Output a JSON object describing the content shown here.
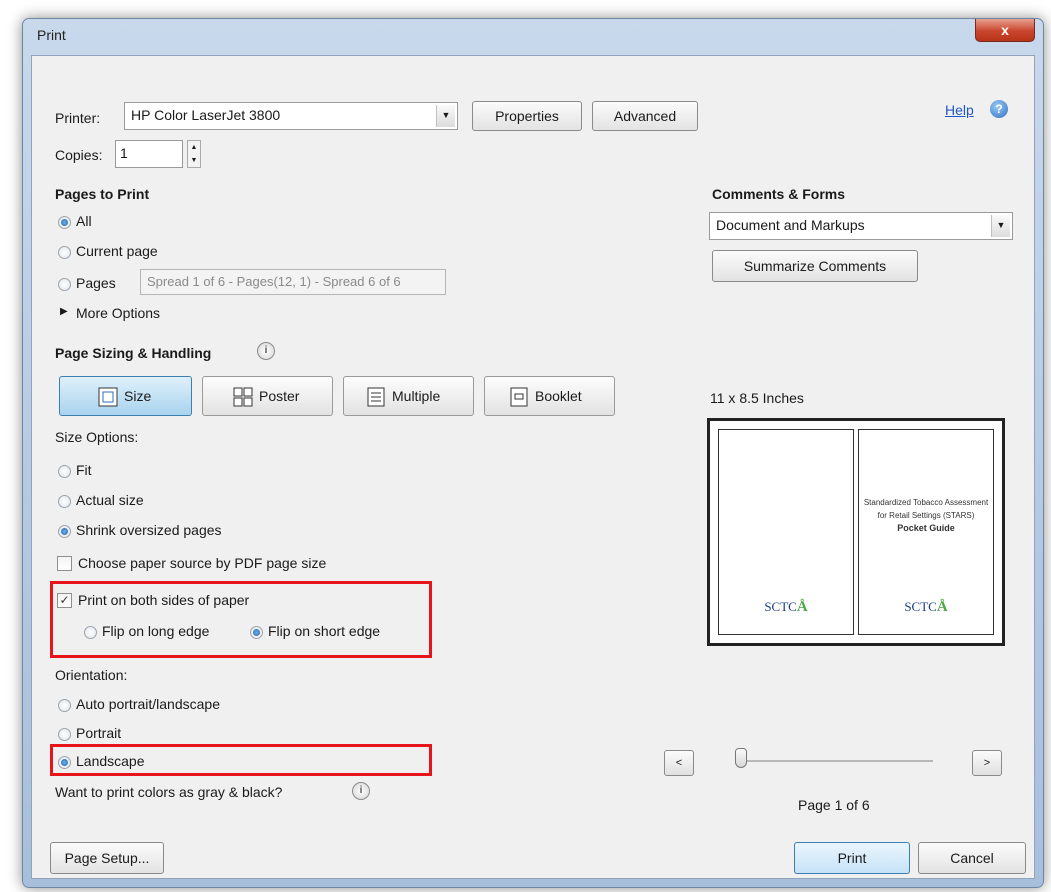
{
  "window": {
    "title": "Print",
    "close_glyph": "x"
  },
  "printer": {
    "label": "Printer:",
    "value": "HP Color LaserJet 3800",
    "properties_label": "Properties",
    "advanced_label": "Advanced",
    "help_label": "Help",
    "help_icon": "help-icon"
  },
  "copies": {
    "label": "Copies:",
    "value": "1"
  },
  "pages_to_print": {
    "heading": "Pages to Print",
    "all_label": "All",
    "current_label": "Current page",
    "pages_label": "Pages",
    "pages_value": "Spread 1 of 6 - Pages(12, 1) - Spread 6 of 6",
    "more_options_label": "More Options",
    "selected": "All"
  },
  "sizing": {
    "heading": "Page Sizing & Handling",
    "tabs": [
      {
        "label": "Size",
        "icon": "size-icon"
      },
      {
        "label": "Poster",
        "icon": "poster-icon"
      },
      {
        "label": "Multiple",
        "icon": "multiple-icon"
      },
      {
        "label": "Booklet",
        "icon": "booklet-icon"
      }
    ],
    "active_tab": "Size",
    "size_options_label": "Size Options:",
    "fit_label": "Fit",
    "actual_label": "Actual size",
    "shrink_label": "Shrink oversized pages",
    "selected_size_option": "Shrink oversized pages",
    "choose_source_label": "Choose paper source by PDF page size",
    "choose_source_checked": false,
    "duplex_label": "Print on both sides of paper",
    "duplex_checked": true,
    "flip_long_label": "Flip on long edge",
    "flip_short_label": "Flip on short edge",
    "flip_selected": "Flip on short edge"
  },
  "orientation": {
    "label": "Orientation:",
    "auto_label": "Auto portrait/landscape",
    "portrait_label": "Portrait",
    "landscape_label": "Landscape",
    "selected": "Landscape"
  },
  "gray_label": "Want to print colors as gray & black?",
  "comments_forms": {
    "heading": "Comments & Forms",
    "value": "Document and Markups",
    "summarize_label": "Summarize Comments"
  },
  "preview": {
    "size_label": "11 x 8.5 Inches",
    "right_page_text": "Standardized Tobacco Assessment for Retail Settings (STARS) Pocket Guide",
    "right_page_title_bold": "Pocket Guide",
    "logo_text": "SCTC",
    "page_indicator": "Page 1 of 6",
    "current_page": 1,
    "total_pages": 6,
    "prev_glyph": "<",
    "next_glyph": ">"
  },
  "footer": {
    "page_setup_label": "Page Setup...",
    "print_label": "Print",
    "cancel_label": "Cancel"
  },
  "colors": {
    "highlight_box": "#e8141c",
    "accent": "#2e6ec2"
  }
}
